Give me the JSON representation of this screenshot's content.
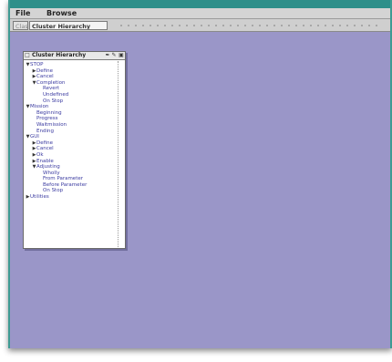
{
  "menu": {
    "file": "File",
    "browse": "Browse"
  },
  "toolbar": {
    "tab_inactive": "Class",
    "tab_active": "Cluster Hierarchy"
  },
  "tree_window": {
    "title": "Cluster Hierarchy"
  },
  "tree": [
    {
      "depth": 0,
      "expanded": true,
      "label": "STOP"
    },
    {
      "depth": 1,
      "expanded": false,
      "label": "Define"
    },
    {
      "depth": 1,
      "expanded": false,
      "label": "Cancel"
    },
    {
      "depth": 1,
      "expanded": true,
      "label": "Completion"
    },
    {
      "depth": 2,
      "expanded": null,
      "label": "Revert"
    },
    {
      "depth": 2,
      "expanded": null,
      "label": "Undefined"
    },
    {
      "depth": 2,
      "expanded": null,
      "label": "On Stop"
    },
    {
      "depth": 0,
      "expanded": true,
      "label": "Mission"
    },
    {
      "depth": 1,
      "expanded": null,
      "label": "Beginning"
    },
    {
      "depth": 1,
      "expanded": null,
      "label": "Progress"
    },
    {
      "depth": 1,
      "expanded": null,
      "label": "Waitmission"
    },
    {
      "depth": 1,
      "expanded": null,
      "label": "Ending"
    },
    {
      "depth": 0,
      "expanded": true,
      "label": "GUI"
    },
    {
      "depth": 1,
      "expanded": false,
      "label": "Define"
    },
    {
      "depth": 1,
      "expanded": false,
      "label": "Cancel"
    },
    {
      "depth": 1,
      "expanded": false,
      "label": "Ok"
    },
    {
      "depth": 1,
      "expanded": false,
      "label": "Enable"
    },
    {
      "depth": 1,
      "expanded": true,
      "label": "Adjusting"
    },
    {
      "depth": 2,
      "expanded": null,
      "label": "Wholly"
    },
    {
      "depth": 2,
      "expanded": null,
      "label": "From Parameter"
    },
    {
      "depth": 2,
      "expanded": null,
      "label": "Before Parameter"
    },
    {
      "depth": 2,
      "expanded": null,
      "label": "On Stop"
    },
    {
      "depth": 0,
      "expanded": false,
      "label": "Utilities"
    }
  ],
  "icons": {
    "expanded": "triangle-down-icon",
    "collapsed": "triangle-right-icon"
  },
  "colors": {
    "workspace": "#9a96c8",
    "frame_accent": "#3f9b93",
    "tree_text": "#3a3aa0"
  }
}
